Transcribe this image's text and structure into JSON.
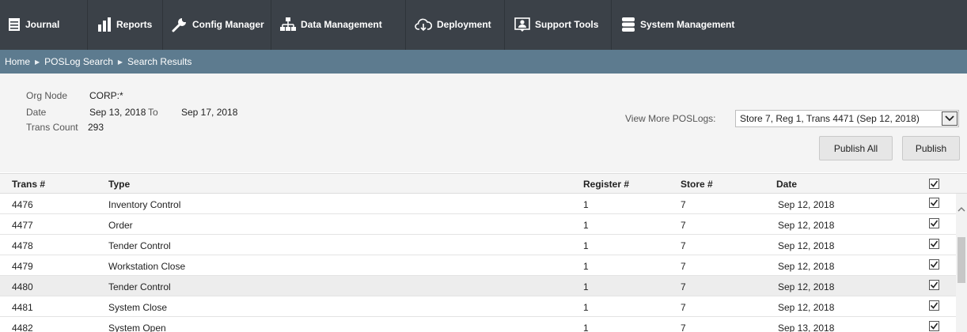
{
  "nav": {
    "items": [
      {
        "label": "Journal",
        "icon": "journal-icon"
      },
      {
        "label": "Reports",
        "icon": "bar-chart-icon"
      },
      {
        "label": "Config Manager",
        "icon": "wrench-icon"
      },
      {
        "label": "Data Management",
        "icon": "hierarchy-icon"
      },
      {
        "label": "Deployment",
        "icon": "cloud-download-icon"
      },
      {
        "label": "Support Tools",
        "icon": "support-person-icon"
      },
      {
        "label": "System Management",
        "icon": "database-icon"
      }
    ]
  },
  "breadcrumb": {
    "items": [
      "Home",
      "POSLog Search",
      "Search Results"
    ]
  },
  "summary": {
    "org_node_label": "Org Node",
    "org_node_value": "CORP:*",
    "date_label": "Date",
    "date_from": "Sep 13, 2018",
    "to_label": "To",
    "date_to": "Sep 17, 2018",
    "trans_count_label": "Trans Count",
    "trans_count_value": "293",
    "view_more_label": "View More POSLogs:",
    "view_more_selected": "Store 7, Reg 1, Trans 4471 (Sep 12, 2018)",
    "publish_all_label": "Publish All",
    "publish_label": "Publish"
  },
  "table": {
    "headers": {
      "trans": "Trans #",
      "type": "Type",
      "register": "Register #",
      "store": "Store #",
      "date": "Date"
    },
    "rows": [
      {
        "trans": "4476",
        "type": "Inventory Control",
        "register": "1",
        "store": "7",
        "date": "Sep 12, 2018",
        "checked": true
      },
      {
        "trans": "4477",
        "type": "Order",
        "register": "1",
        "store": "7",
        "date": "Sep 12, 2018",
        "checked": true
      },
      {
        "trans": "4478",
        "type": "Tender Control",
        "register": "1",
        "store": "7",
        "date": "Sep 12, 2018",
        "checked": true
      },
      {
        "trans": "4479",
        "type": "Workstation Close",
        "register": "1",
        "store": "7",
        "date": "Sep 12, 2018",
        "checked": true
      },
      {
        "trans": "4480",
        "type": "Tender Control",
        "register": "1",
        "store": "7",
        "date": "Sep 12, 2018",
        "checked": true
      },
      {
        "trans": "4481",
        "type": "System Close",
        "register": "1",
        "store": "7",
        "date": "Sep 12, 2018",
        "checked": true
      },
      {
        "trans": "4482",
        "type": "System Open",
        "register": "1",
        "store": "7",
        "date": "Sep 13, 2018",
        "checked": true
      }
    ],
    "highlighted_row": 4
  },
  "colors": {
    "nav_bg": "#3b4148",
    "breadcrumb_bg": "#5d7b8f",
    "panel_bg": "#f4f4f4",
    "row_highlight": "#ededed"
  }
}
